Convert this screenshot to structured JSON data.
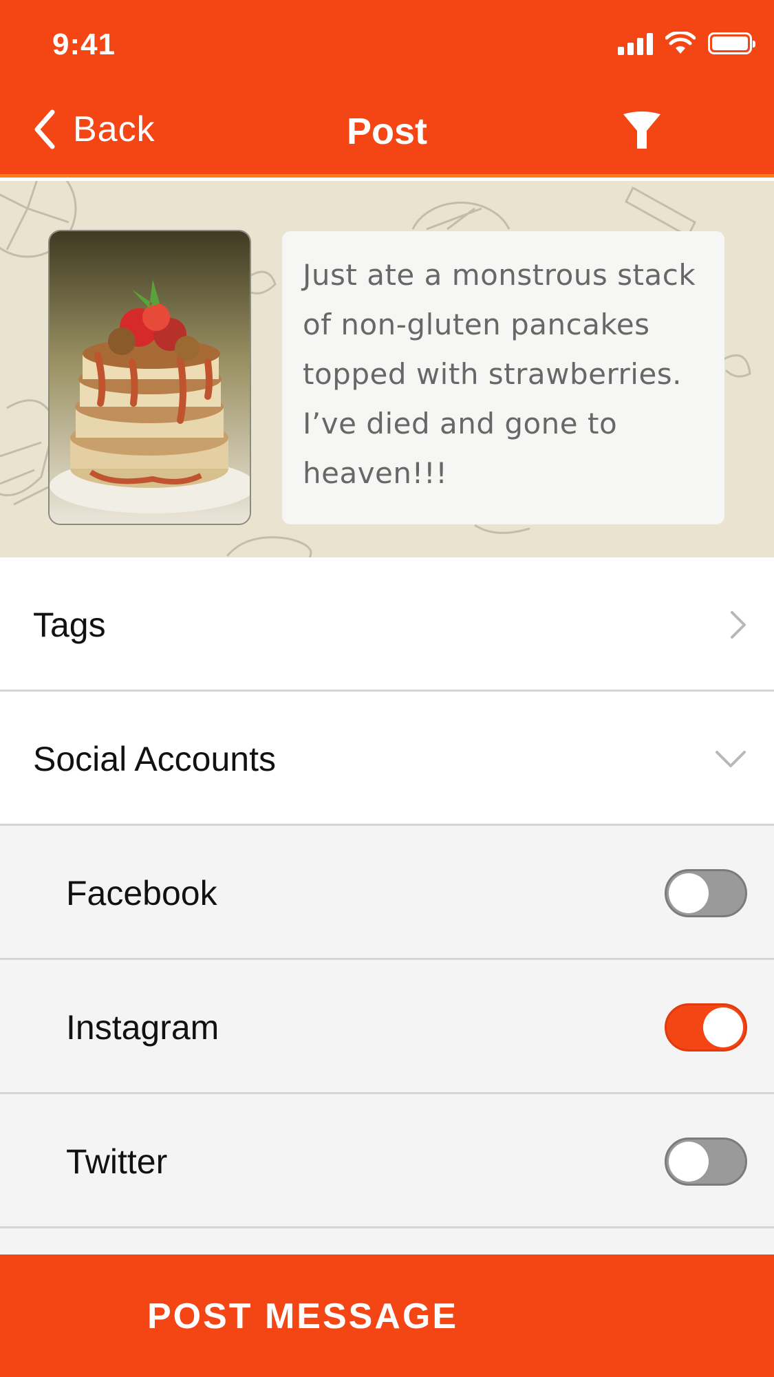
{
  "status_bar": {
    "time": "9:41"
  },
  "nav": {
    "back_label": "Back",
    "title": "Post"
  },
  "post": {
    "caption": "Just ate a monstrous stack of non-gluten pancakes topped with strawberries. I’ve died and gone to heaven!!!"
  },
  "rows": {
    "tags": {
      "label": "Tags"
    },
    "social": {
      "label": "Social Accounts",
      "expanded": true
    },
    "facebook": {
      "label": "Facebook",
      "enabled": false
    },
    "instagram": {
      "label": "Instagram",
      "enabled": true
    },
    "twitter": {
      "label": "Twitter",
      "enabled": false
    }
  },
  "action": {
    "label": "POST MESSAGE"
  },
  "colors": {
    "accent": "#f44615",
    "header_underline": "#ff7a1a",
    "hero_bg": "#e9e3cf"
  },
  "icons": [
    "signal-icon",
    "wifi-icon",
    "battery-icon",
    "back-chevron-icon",
    "filter-icon",
    "chevron-right-icon",
    "chevron-down-icon"
  ]
}
